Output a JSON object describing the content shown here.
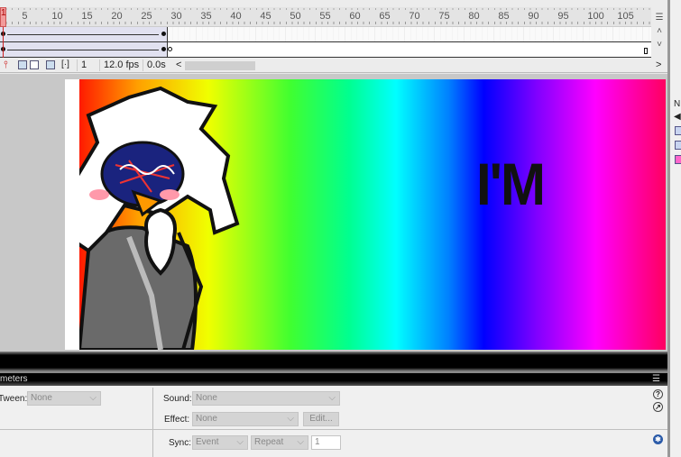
{
  "timeline": {
    "ruler_ticks": [
      "1",
      "5",
      "10",
      "15",
      "20",
      "25",
      "30",
      "35",
      "40",
      "45",
      "50",
      "55",
      "60",
      "65",
      "70",
      "75",
      "80",
      "85",
      "90",
      "95",
      "100",
      "105"
    ],
    "current_frame": "1",
    "frame_rate": "12.0 fps",
    "elapsed": "0.0s",
    "scroll_left": "<",
    "scroll_right": ">",
    "side_top": "4"
  },
  "stage": {
    "text": "I'M"
  },
  "right_panel": {
    "header": "N"
  },
  "properties": {
    "title": "meters",
    "tween_label": "Tween:",
    "tween_value": "None",
    "sound_label": "Sound:",
    "sound_value": "None",
    "effect_label": "Effect:",
    "effect_value": "None",
    "edit_button": "Edit...",
    "sync_label": "Sync:",
    "sync_value": "Event",
    "repeat_value": "Repeat",
    "repeat_count": "1"
  },
  "colors": {
    "playhead": "#f29b9b",
    "panel_header": "#000000"
  }
}
